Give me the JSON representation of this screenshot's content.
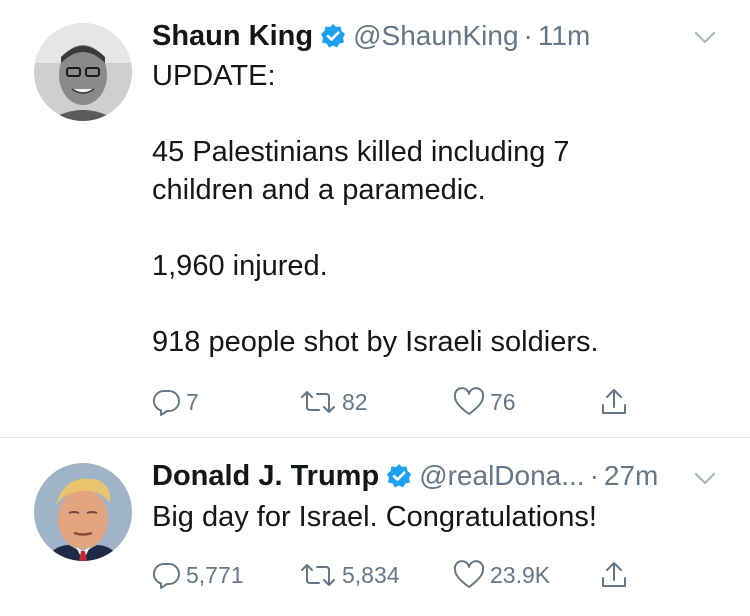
{
  "colors": {
    "text": "#14171a",
    "secondary": "#657786",
    "verified": "#1da1f2",
    "divider": "#e1e8ed",
    "background": "#ffffff"
  },
  "tweets": [
    {
      "name": "Shaun King",
      "handle": "@ShaunKing",
      "separator": "·",
      "time": "11m",
      "verified": true,
      "text_lines": [
        "UPDATE:",
        "",
        "45 Palestinians killed including 7",
        "children and a paramedic.",
        "",
        "1,960 injured.",
        "",
        "918 people shot by Israeli soldiers."
      ],
      "replies": "7",
      "retweets": "82",
      "likes": "76",
      "icons": [
        "reply-icon",
        "retweet-icon",
        "like-icon",
        "share-icon",
        "chevron-down-icon",
        "verified-badge-icon"
      ]
    },
    {
      "name": "Donald J. Trump",
      "handle": "@realDona...",
      "separator": "·",
      "time": "27m",
      "verified": true,
      "text_lines": [
        "Big day for Israel. Congratulations!"
      ],
      "replies": "5,771",
      "retweets": "5,834",
      "likes": "23.9K",
      "icons": [
        "reply-icon",
        "retweet-icon",
        "like-icon",
        "share-icon",
        "chevron-down-icon",
        "verified-badge-icon"
      ]
    }
  ]
}
